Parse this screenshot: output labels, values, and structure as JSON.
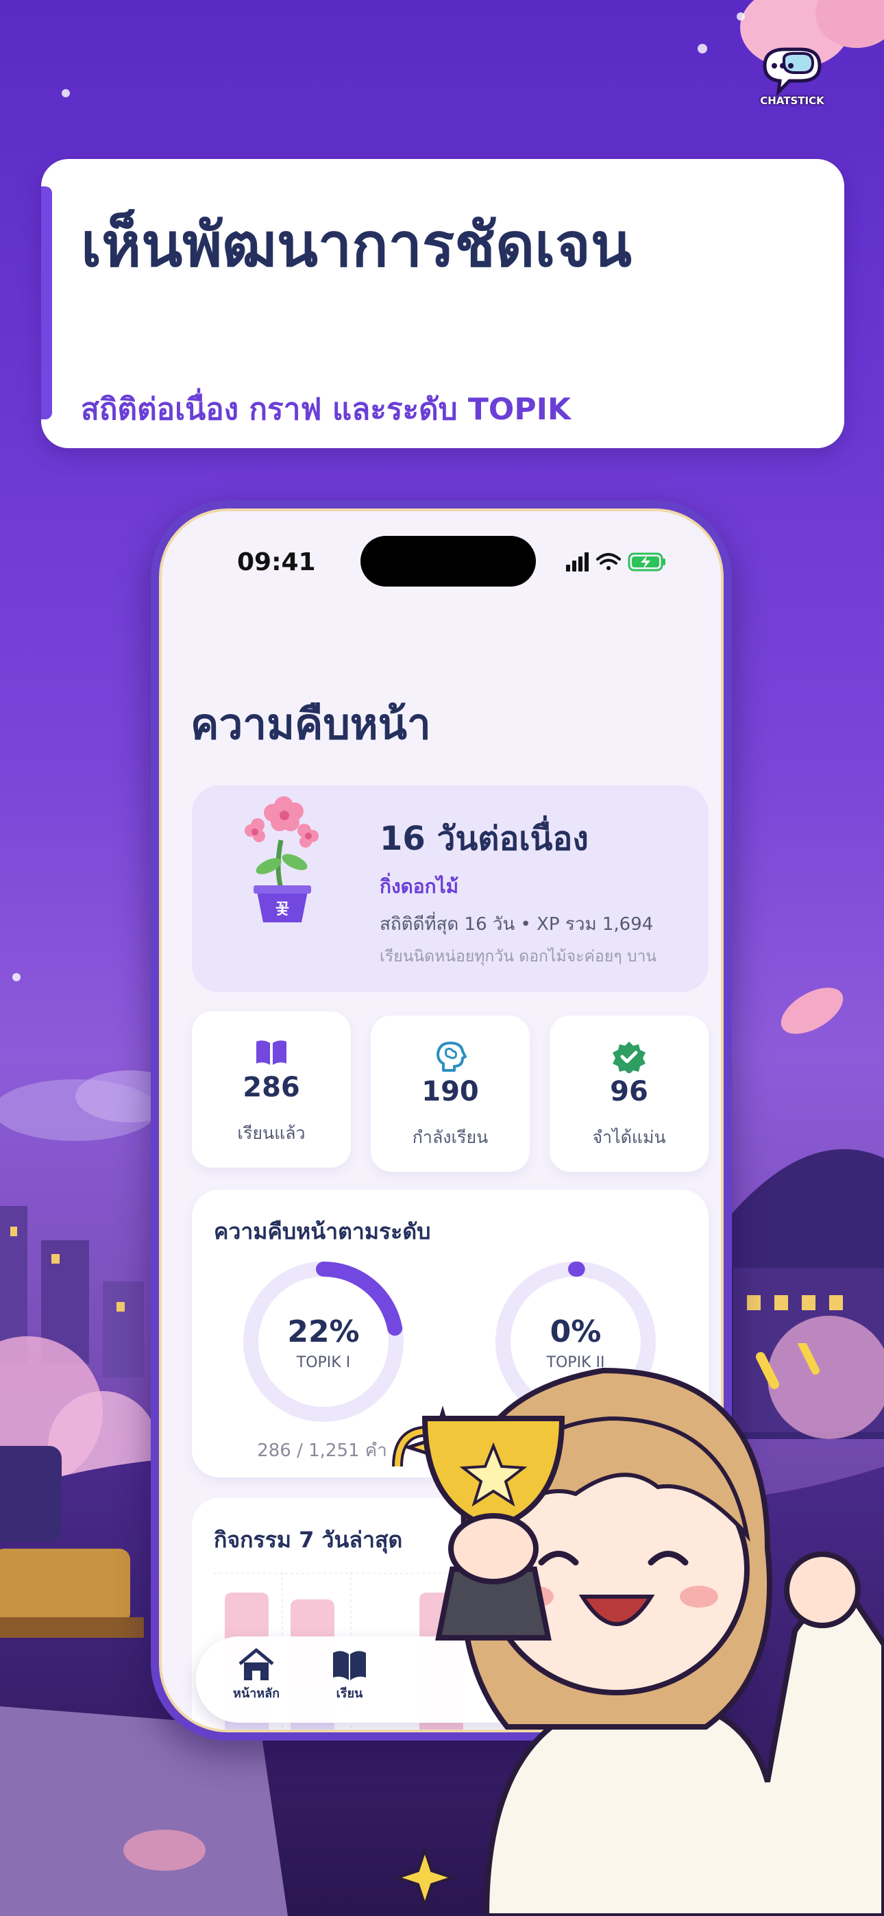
{
  "header": {
    "title": "เห็นพัฒนาการชัดเจน",
    "subtitle": "สถิติต่อเนื่อง กราฟ และระดับ TOPIK"
  },
  "brand": {
    "logo_text": "CHATSTICK"
  },
  "status_bar": {
    "time": "09:41"
  },
  "page": {
    "title": "ความคืบหน้า"
  },
  "streak": {
    "title": "16 วันต่อเนื่อง",
    "level": "กิ่งดอกไม้",
    "stats": "สถิติดีที่สุด 16 วัน • XP รวม 1,694",
    "tip": "เรียนนิดหน่อยทุกวัน ดอกไม้จะค่อยๆ บาน",
    "pot_char": "꽃"
  },
  "stats": [
    {
      "value": "286",
      "label": "เรียนแล้ว",
      "icon": "book-icon"
    },
    {
      "value": "190",
      "label": "กำลังเรียน",
      "icon": "brain-icon"
    },
    {
      "value": "96",
      "label": "จำได้แม่น",
      "icon": "verified-icon"
    }
  ],
  "level_progress": {
    "heading": "ความคืบหน้าตามระดับ",
    "levels": [
      {
        "name": "TOPIK I",
        "percent_text": "22%",
        "progress": 0.22,
        "count": "286 / 1,251 คำ"
      },
      {
        "name": "TOPIK II",
        "percent_text": "0%",
        "progress": 0.0
      }
    ]
  },
  "activity": {
    "heading": "กิจกรรม 7 วันล่าสุด"
  },
  "tabbar": [
    {
      "label": "หน้าหลัก",
      "icon": "home-icon"
    },
    {
      "label": "เรียน",
      "icon": "open-book-icon"
    }
  ],
  "colors": {
    "accent": "#6a3fd6",
    "navy": "#25305e",
    "ring_track": "#ece7fb",
    "ring_fill": "#7248e0",
    "success": "#2e9e62"
  }
}
